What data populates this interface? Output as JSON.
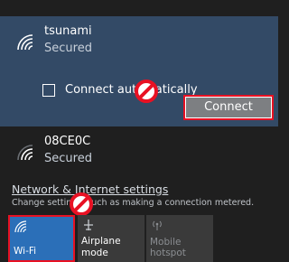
{
  "networks": [
    {
      "ssid": "tsunami",
      "security": "Secured",
      "selected": true
    },
    {
      "ssid": "08CE0C",
      "security": "Secured",
      "selected": false
    }
  ],
  "connect_auto_label": "Connect automatically",
  "connect_auto_checked": false,
  "connect_button_label": "Connect",
  "settings": {
    "link_label": "Network & Internet settings",
    "description": "Change settings, such as making a connection metered."
  },
  "quick_actions": [
    {
      "label": "Wi-Fi",
      "icon": "wifi-icon",
      "active": true
    },
    {
      "label": "Airplane mode",
      "icon": "airplane-icon",
      "active": false
    },
    {
      "label": "Mobile hotspot",
      "icon": "hotspot-icon",
      "active": false
    }
  ],
  "colors": {
    "accent": "#2b6fb8",
    "selected_bg": "#334a66",
    "highlight_red": "#e81123"
  }
}
